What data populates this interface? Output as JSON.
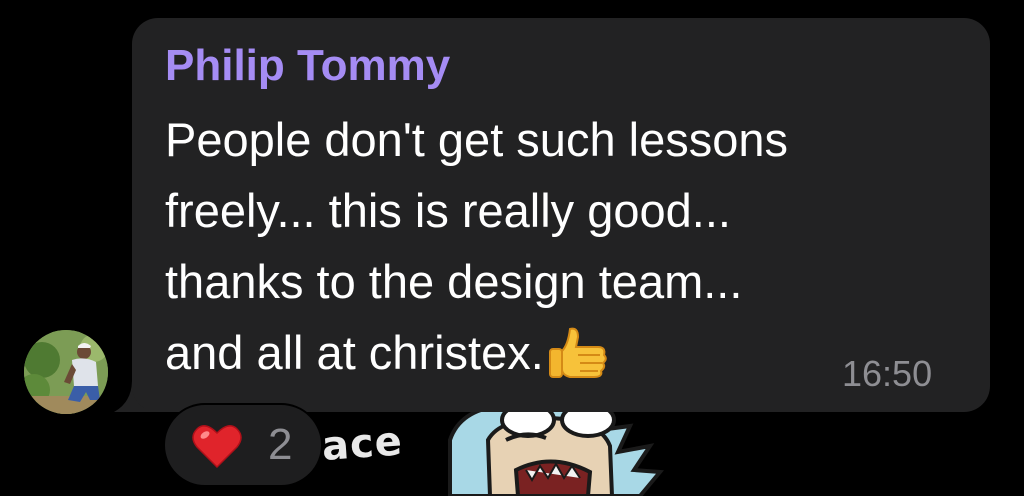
{
  "message": {
    "sender_name": "Philip Tommy",
    "lines": [
      "People don't get such lessons",
      "freely... this is really good...",
      "thanks to the design team...",
      "and all at christex."
    ],
    "trailing_emoji": "thumbs-up",
    "time": "16:50"
  },
  "reaction": {
    "emoji": "red-heart",
    "count": "2"
  },
  "sticker": {
    "visible_text": "ace"
  },
  "colors": {
    "background": "#000000",
    "bubble": "#222223",
    "sender_name": "#a58cf4",
    "message_text": "#ffffff",
    "timestamp": "#8e8e93"
  }
}
